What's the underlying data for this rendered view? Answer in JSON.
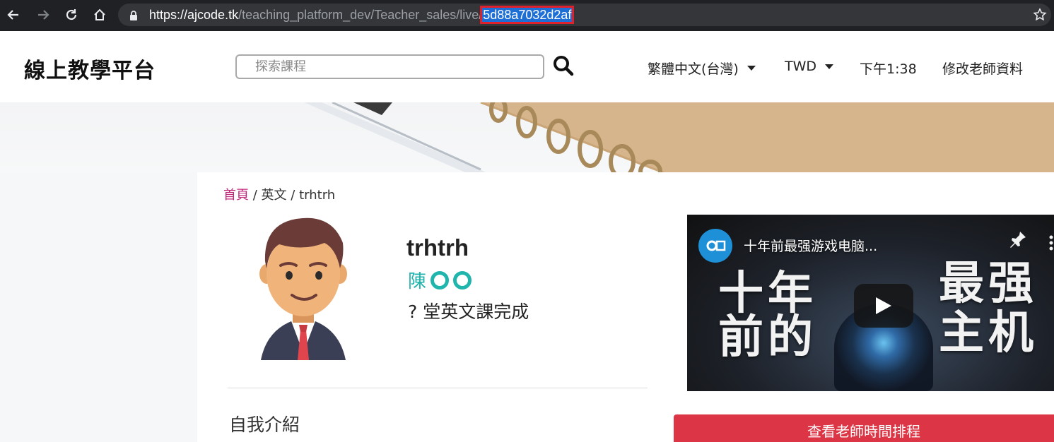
{
  "browser": {
    "url_host": "https://ajcode.tk",
    "url_path": "/teaching_platform_dev/Teacher_sales/live/",
    "url_selected": "5d88a7032d2af"
  },
  "header": {
    "brand": "線上教學平台",
    "search_placeholder": "探索課程",
    "language": "繁體中文(台灣)",
    "currency": "TWD",
    "time": "下午1:38",
    "edit_profile": "修改老師資料"
  },
  "breadcrumb": {
    "home": "首頁",
    "sep": "/",
    "category": "英文",
    "current": "trhtrh"
  },
  "teacher": {
    "name": "trhtrh",
    "real_name": "陳",
    "lessons": "? 堂英文課完成"
  },
  "video": {
    "title": "十年前最强游戏电脑...",
    "overlay_left_top": "十年",
    "overlay_left_bottom": "前的",
    "overlay_right_top": "最强",
    "overlay_right_bottom": "主机"
  },
  "intro": {
    "title": "自我介紹"
  },
  "actions": {
    "schedule": "查看老師時間排程"
  },
  "colors": {
    "accent_teal": "#1fb5ad",
    "home_link": "#c0267a",
    "schedule_button": "#dc3545",
    "url_highlight": "#1d6fd6",
    "url_outline": "#e0202a"
  }
}
